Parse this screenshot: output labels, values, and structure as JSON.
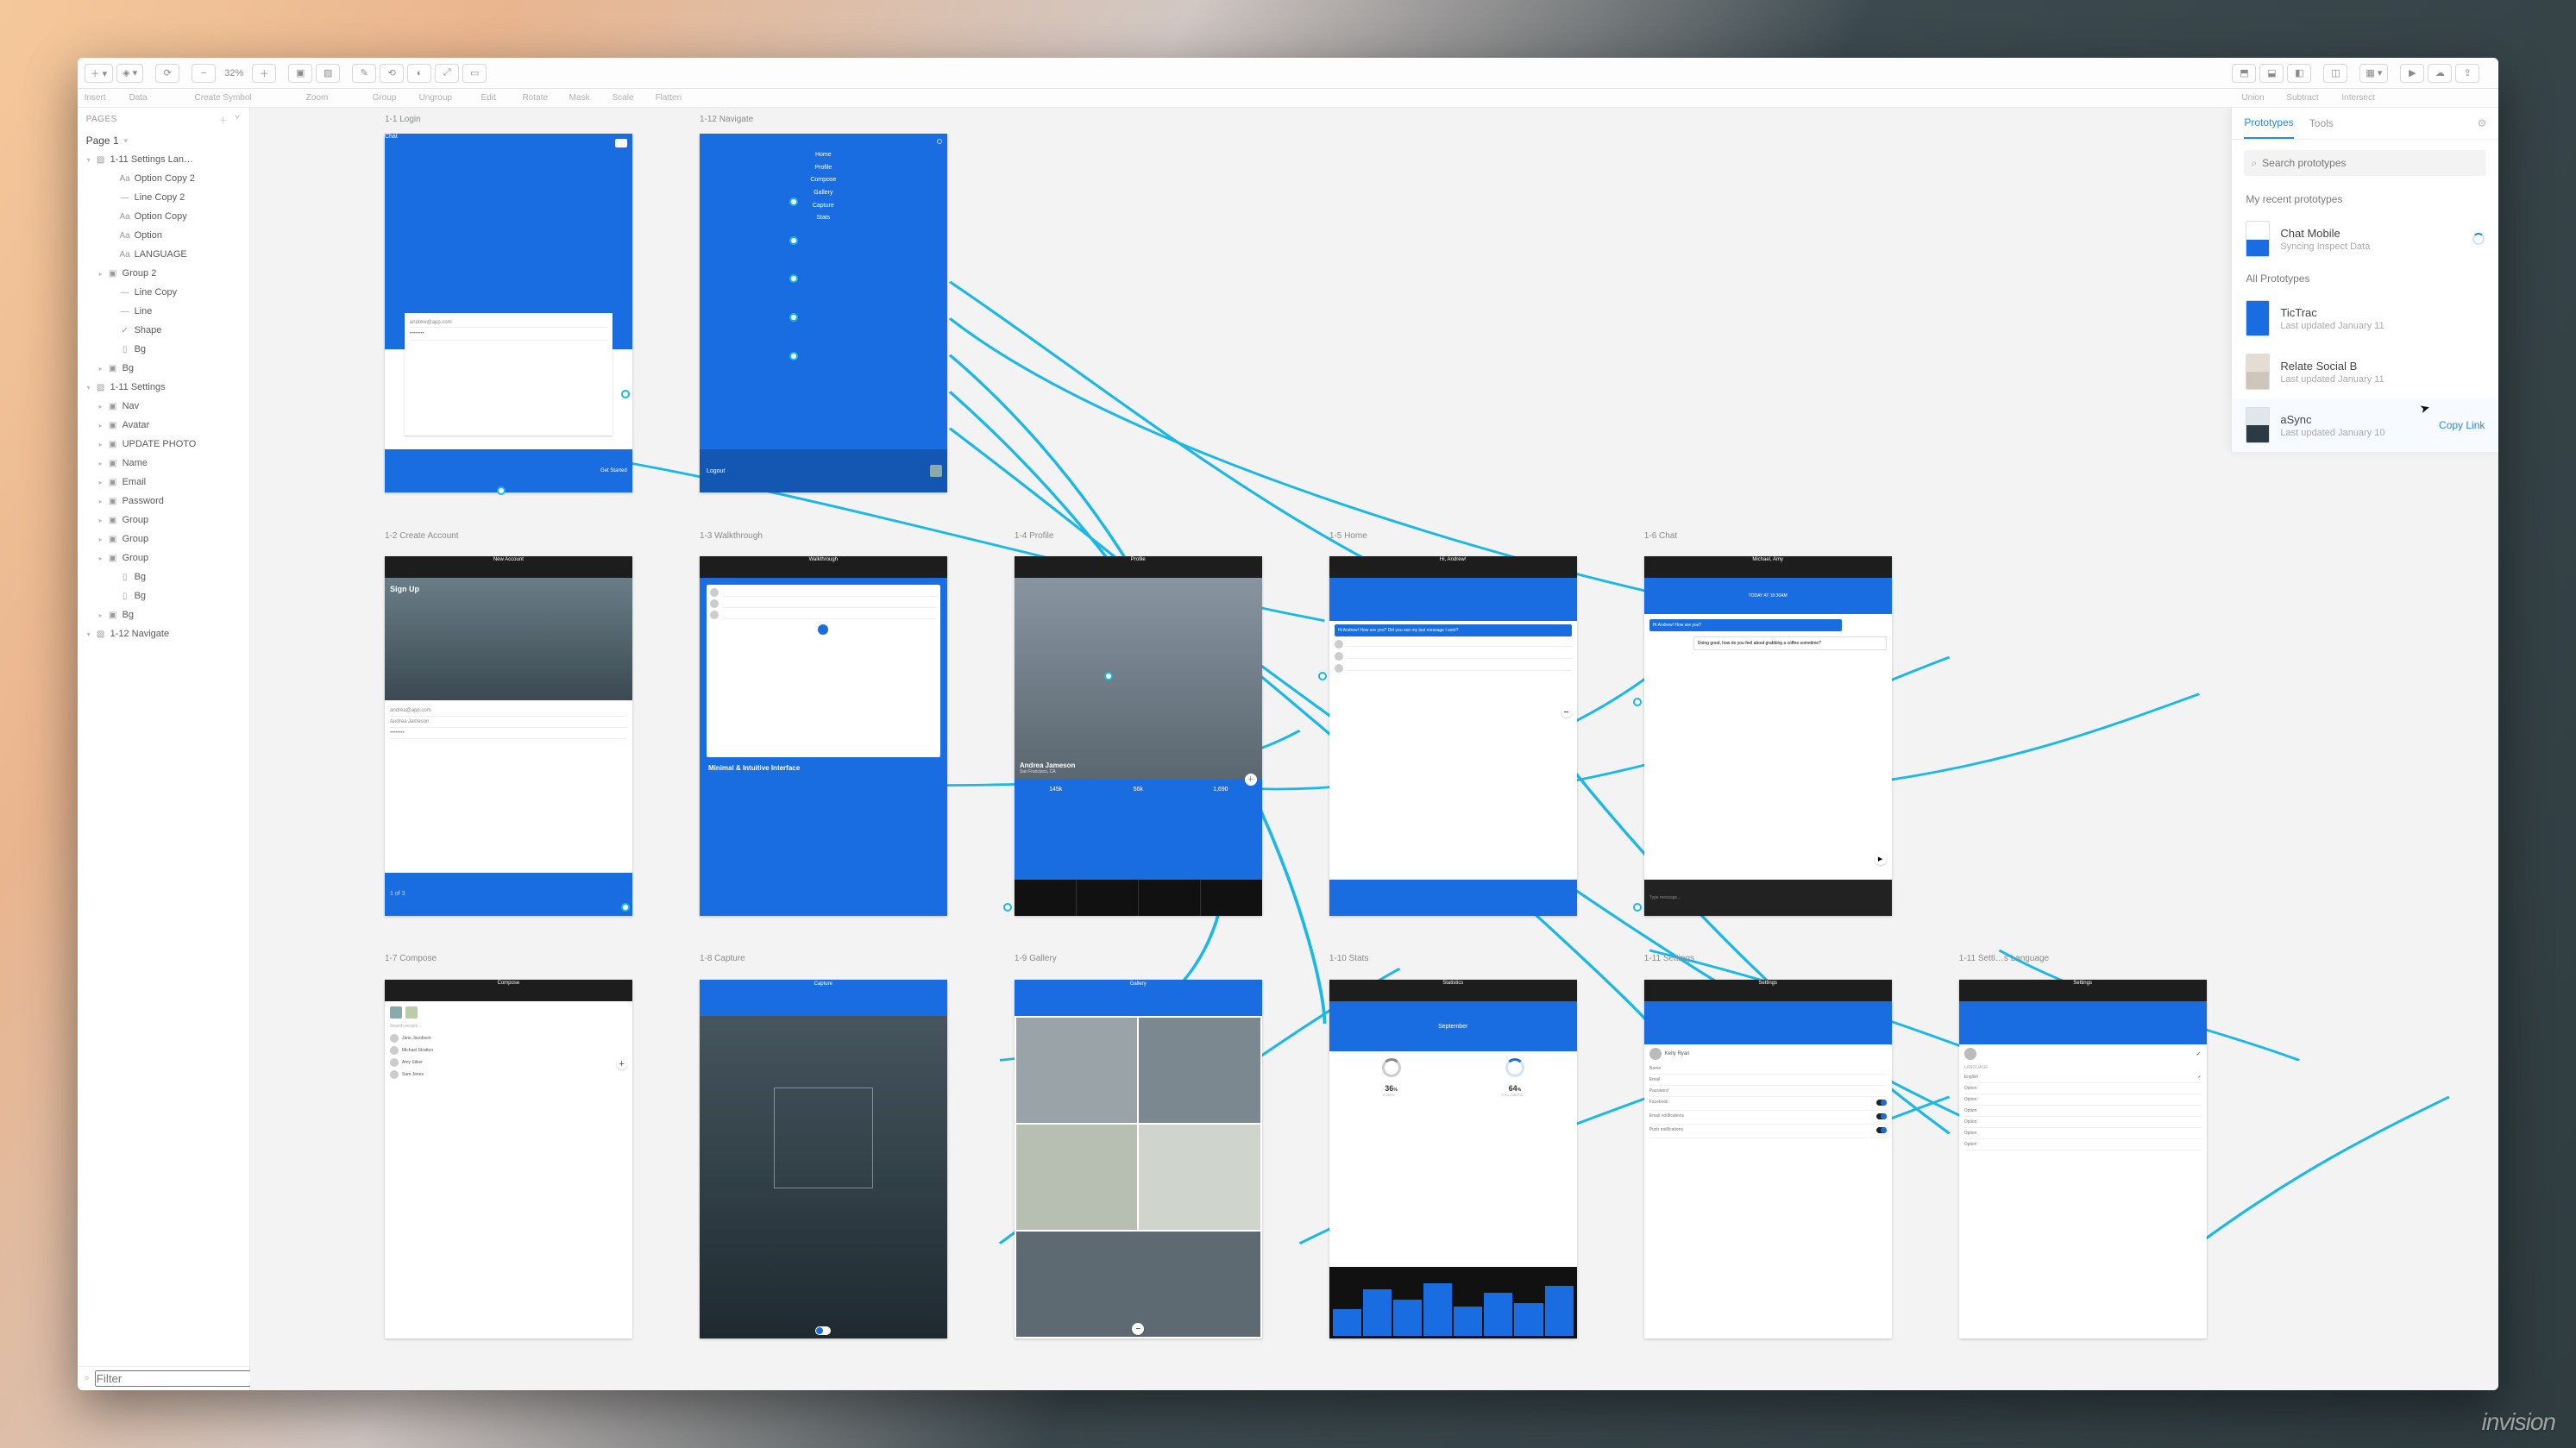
{
  "toolbar": {
    "labels": {
      "insert": "Insert",
      "data": "Data",
      "create_symbol": "Create Symbol",
      "zoom": "Zoom",
      "group": "Group",
      "ungroup": "Ungroup",
      "edit": "Edit",
      "rotate": "Rotate",
      "mask": "Mask",
      "scale": "Scale",
      "flatten": "Flatten",
      "union": "Union",
      "subtract": "Subtract",
      "intersect": "Intersect"
    },
    "zoom_value": "32%"
  },
  "pages": {
    "header": "PAGES",
    "current": "Page 1"
  },
  "layers": [
    {
      "d": 0,
      "c": "▾",
      "i": "▧",
      "t": "1-11 Settings Lan…",
      "sel": false
    },
    {
      "d": 2,
      "c": "",
      "i": "Aa",
      "t": "Option Copy 2"
    },
    {
      "d": 2,
      "c": "",
      "i": "—",
      "t": "Line Copy 2"
    },
    {
      "d": 2,
      "c": "",
      "i": "Aa",
      "t": "Option Copy"
    },
    {
      "d": 2,
      "c": "",
      "i": "Aa",
      "t": "Option"
    },
    {
      "d": 2,
      "c": "",
      "i": "Aa",
      "t": "LANGUAGE"
    },
    {
      "d": 1,
      "c": "▸",
      "i": "▣",
      "t": "Group 2"
    },
    {
      "d": 2,
      "c": "",
      "i": "—",
      "t": "Line Copy"
    },
    {
      "d": 2,
      "c": "",
      "i": "—",
      "t": "Line"
    },
    {
      "d": 2,
      "c": "",
      "i": "✓",
      "t": "Shape"
    },
    {
      "d": 2,
      "c": "",
      "i": "▯",
      "t": "Bg"
    },
    {
      "d": 1,
      "c": "▸",
      "i": "▣",
      "t": "Bg"
    },
    {
      "d": 0,
      "c": "▾",
      "i": "▧",
      "t": "1-11 Settings"
    },
    {
      "d": 1,
      "c": "▸",
      "i": "▣",
      "t": "Nav"
    },
    {
      "d": 1,
      "c": "▸",
      "i": "▣",
      "t": "Avatar"
    },
    {
      "d": 1,
      "c": "▸",
      "i": "▣",
      "t": "UPDATE PHOTO"
    },
    {
      "d": 1,
      "c": "▸",
      "i": "▣",
      "t": "Name"
    },
    {
      "d": 1,
      "c": "▸",
      "i": "▣",
      "t": "Email"
    },
    {
      "d": 1,
      "c": "▸",
      "i": "▣",
      "t": "Password"
    },
    {
      "d": 1,
      "c": "▸",
      "i": "▣",
      "t": "Group"
    },
    {
      "d": 1,
      "c": "▸",
      "i": "▣",
      "t": "Group"
    },
    {
      "d": 1,
      "c": "▸",
      "i": "▣",
      "t": "Group"
    },
    {
      "d": 2,
      "c": "",
      "i": "▯",
      "t": "Bg"
    },
    {
      "d": 2,
      "c": "",
      "i": "▯",
      "t": "Bg"
    },
    {
      "d": 1,
      "c": "▸",
      "i": "▣",
      "t": "Bg"
    },
    {
      "d": 0,
      "c": "▾",
      "i": "▧",
      "t": "1-12 Navigate"
    }
  ],
  "filter": {
    "placeholder": "Filter"
  },
  "artboards": {
    "login": {
      "label": "1-1 Login",
      "title": "Chat",
      "email": "andrew@app.com",
      "cta": "Get Started"
    },
    "navigate": {
      "label": "1-12 Navigate",
      "items": [
        "Home",
        "Profile",
        "Compose",
        "Gallery",
        "Capture",
        "Stats"
      ],
      "logout": "Logout"
    },
    "create": {
      "label": "1-2 Create Account",
      "title": "Sign Up",
      "step": "1 of 3"
    },
    "walkthrough": {
      "label": "1-3 Walkthrough",
      "tag": "Minimal & Intuitive Interface",
      "head": "Walkthrough"
    },
    "profile": {
      "label": "1-4 Profile",
      "name": "Andrea Jameson",
      "loc": "San Francisco, CA",
      "stats": [
        "145k",
        "56k",
        "1,690"
      ],
      "head": "Profile"
    },
    "home": {
      "label": "1-5 Home",
      "user": "Hi, Andrew!",
      "q": "Hi Andrew! How are you? Did you see my last message I sent?",
      "head": "Hi, Andrew!"
    },
    "chatv": {
      "label": "1-6 Chat",
      "name": "Michael, Amy",
      "line": "Doing good, how do you feel about grabbing a coffee sometime?",
      "typing": "Type message..."
    },
    "compose": {
      "label": "1-7 Compose",
      "head": "Compose",
      "hint": "Search people..."
    },
    "capture": {
      "label": "1-8 Capture",
      "head": "Capture"
    },
    "gallery": {
      "label": "1-9 Gallery",
      "head": "Gallery"
    },
    "stats": {
      "label": "1-10 Stats",
      "head": "Statistics",
      "month": "September",
      "v1": "36",
      "u1": "%",
      "v2": "64",
      "u2": "%",
      "l1": "POSTS",
      "l2": "FOLLOWERS"
    },
    "settings": {
      "label": "1-11 Settings",
      "head": "Settings",
      "name": "Kelly Ryan",
      "rows": [
        "Name",
        "Email",
        "Password",
        "Facebook",
        "Email notifications",
        "Push notifications"
      ]
    },
    "settingslang": {
      "label": "1-11 Setti…s Language",
      "head": "Settings",
      "section": "LANGUAGE",
      "rows": [
        "English",
        "Option",
        "Option",
        "Option",
        "Option",
        "Option",
        "Option"
      ]
    }
  },
  "panel": {
    "tabs": {
      "prototypes": "Prototypes",
      "tools": "Tools"
    },
    "search_placeholder": "Search prototypes",
    "recent_title": "My recent prototypes",
    "recent": {
      "name": "Chat Mobile",
      "sub": "Syncing Inspect Data"
    },
    "all_title": "All Prototypes",
    "items": [
      {
        "name": "TicTrac",
        "sub": "Last updated January 11",
        "thumb": "#1a6de0"
      },
      {
        "name": "Relate Social B",
        "sub": "Last updated January 11",
        "thumb": "#d9d4cf"
      },
      {
        "name": "aSync",
        "sub": "Last updated January 10",
        "thumb": "#2b3a44"
      }
    ],
    "copy_link": "Copy Link"
  },
  "brand": "invision"
}
